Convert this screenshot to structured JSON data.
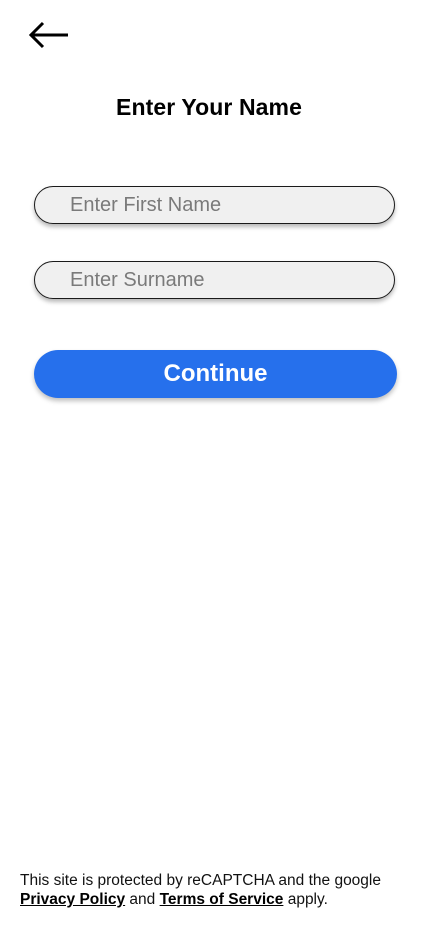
{
  "header": {
    "back_icon": "arrow-left-icon"
  },
  "page": {
    "title": "Enter Your Name"
  },
  "form": {
    "first_name": {
      "value": "",
      "placeholder": "Enter First Name"
    },
    "surname": {
      "value": "",
      "placeholder": "Enter Surname"
    },
    "continue_label": "Continue"
  },
  "footer": {
    "text_part1": "This site is protected by reCAPTCHA and the google ",
    "privacy_link": "Privacy Policy",
    "text_and": " and ",
    "terms_link": "Terms of Service",
    "text_end": " apply."
  },
  "colors": {
    "primary_button": "#2670ec",
    "input_background": "#f0f0f0",
    "text": "#000000"
  }
}
